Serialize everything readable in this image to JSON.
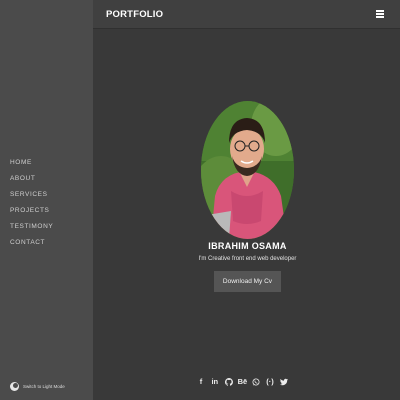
{
  "header": {
    "brand": "PORTFOLIO",
    "menu_icon": "hamburger-menu-icon"
  },
  "sidebar": {
    "items": [
      {
        "label": "HOME"
      },
      {
        "label": "ABOUT"
      },
      {
        "label": "SERVICES"
      },
      {
        "label": "PROJECTS"
      },
      {
        "label": "TESTIMONY"
      },
      {
        "label": "CONTACT"
      }
    ],
    "mode_toggle_label": "Switch to Light Mode",
    "mode_toggle_icon": "moon-icon"
  },
  "hero": {
    "name": "IBRAHIM OSAMA",
    "tagline": "I'm Creative front end web developer",
    "cv_button": "Download My Cv",
    "avatar_icon": "profile-photo"
  },
  "socials": [
    {
      "icon": "facebook-icon",
      "glyph": "f"
    },
    {
      "icon": "linkedin-icon",
      "glyph": "in"
    },
    {
      "icon": "github-icon"
    },
    {
      "icon": "behance-icon",
      "glyph": "Bē"
    },
    {
      "icon": "whatsapp-icon"
    },
    {
      "icon": "codepen-icon",
      "glyph": "(·)"
    },
    {
      "icon": "twitter-icon"
    }
  ],
  "colors": {
    "page_bg": "#393939",
    "sidebar_bg": "#4b4b4b",
    "topbar_bg": "#404040",
    "button_bg": "#555555",
    "text": "#ffffff"
  }
}
